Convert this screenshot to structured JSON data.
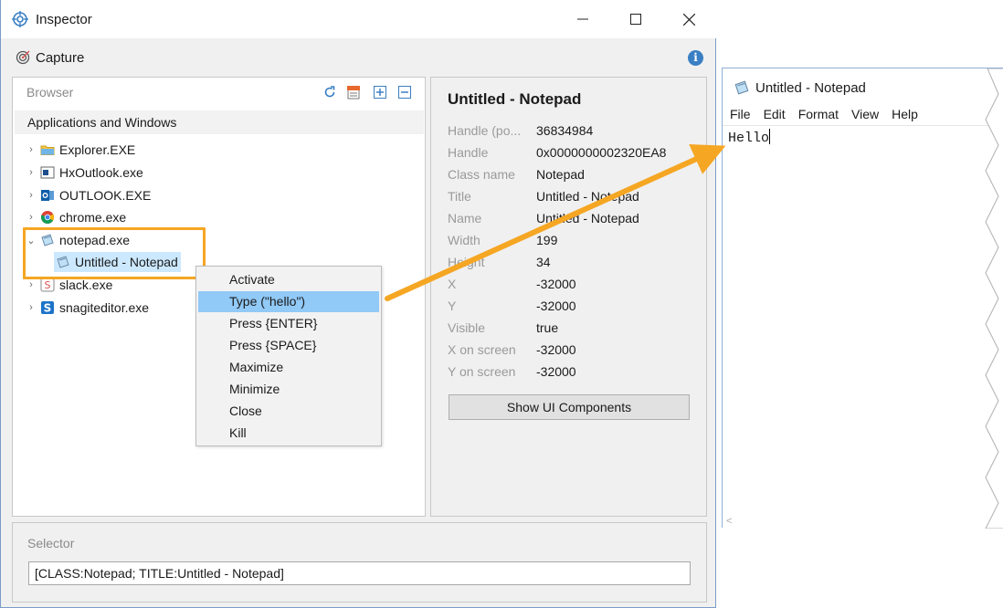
{
  "inspector": {
    "title": "Inspector",
    "capture_label": "Capture",
    "info_icon": "i"
  },
  "browser": {
    "header": "Browser",
    "section_title": "Applications and Windows",
    "toolbar_icons": [
      "refresh-icon",
      "xml-icon",
      "expand-all-icon",
      "collapse-all-icon"
    ],
    "tree": [
      {
        "label": "Explorer.EXE",
        "icon": "folder-icon",
        "expanded": false
      },
      {
        "label": "HxOutlook.exe",
        "icon": "hxoutlook-icon",
        "expanded": false
      },
      {
        "label": "OUTLOOK.EXE",
        "icon": "outlook-icon",
        "expanded": false
      },
      {
        "label": "chrome.exe",
        "icon": "chrome-icon",
        "expanded": false
      },
      {
        "label": "notepad.exe",
        "icon": "notepad-icon",
        "expanded": true,
        "children": [
          {
            "label": "Untitled - Notepad",
            "icon": "notepad-icon",
            "selected": true
          }
        ]
      },
      {
        "label": "slack.exe",
        "icon": "slack-icon",
        "expanded": false
      },
      {
        "label": "snagiteditor.exe",
        "icon": "snagit-icon",
        "expanded": false
      }
    ]
  },
  "context_menu": {
    "items": [
      "Activate",
      "Type (\"hello\")",
      "Press {ENTER}",
      "Press {SPACE}",
      "Maximize",
      "Minimize",
      "Close",
      "Kill"
    ],
    "active_index": 1
  },
  "details": {
    "title": "Untitled - Notepad",
    "props": [
      {
        "key": "Handle (po...",
        "value": "36834984"
      },
      {
        "key": "Handle",
        "value": "0x0000000002320EA8"
      },
      {
        "key": "Class name",
        "value": "Notepad"
      },
      {
        "key": "Title",
        "value": "Untitled - Notepad"
      },
      {
        "key": "Name",
        "value": "Untitled - Notepad"
      },
      {
        "key": "Width",
        "value": "199"
      },
      {
        "key": "Height",
        "value": "34"
      },
      {
        "key": "X",
        "value": "-32000"
      },
      {
        "key": "Y",
        "value": "-32000"
      },
      {
        "key": "Visible",
        "value": "true"
      },
      {
        "key": "X on screen",
        "value": "-32000"
      },
      {
        "key": "Y on screen",
        "value": "-32000"
      }
    ],
    "show_button": "Show UI Components"
  },
  "selector": {
    "header": "Selector",
    "value": "[CLASS:Notepad; TITLE:Untitled - Notepad]"
  },
  "notepad": {
    "title": "Untitled - Notepad",
    "menu": [
      "File",
      "Edit",
      "Format",
      "View",
      "Help"
    ],
    "text": "Hello"
  },
  "colors": {
    "highlight": "#f5a623",
    "menu_active": "#91c9f7",
    "tree_selected": "#cce8ff"
  }
}
